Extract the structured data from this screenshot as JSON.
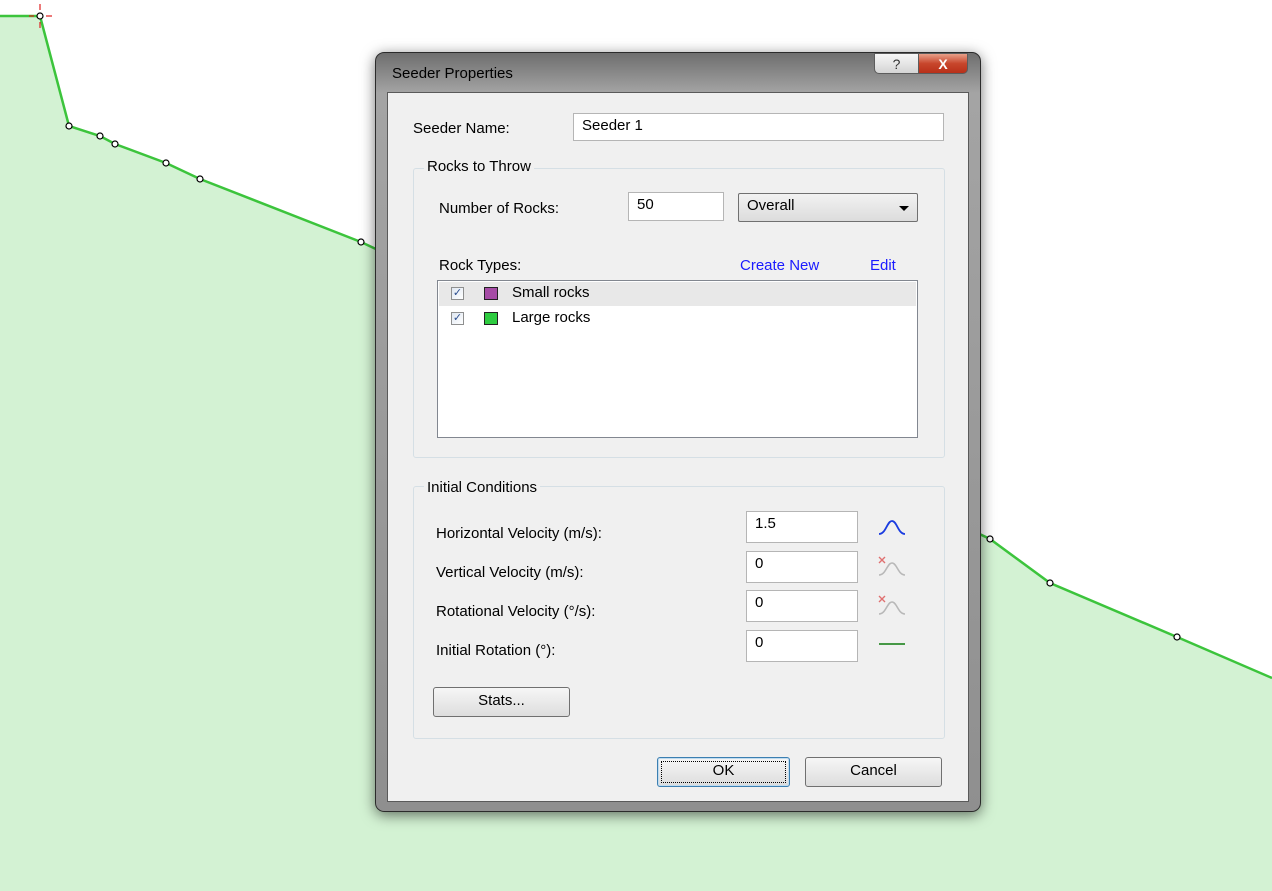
{
  "dialog": {
    "title": "Seeder Properties",
    "help_glyph": "?",
    "close_glyph": "X",
    "seeder_name_label": "Seeder Name:",
    "seeder_name_value": "Seeder 1",
    "rocks_group": {
      "title": "Rocks to Throw",
      "number_label": "Number of Rocks:",
      "number_value": "50",
      "mode_selected": "Overall",
      "rock_types_label": "Rock Types:",
      "create_new_link": "Create New",
      "edit_link": "Edit",
      "items": [
        {
          "label": "Small rocks",
          "checked": true,
          "color": "#a64ca6"
        },
        {
          "label": "Large rocks",
          "checked": true,
          "color": "#2ecc40"
        }
      ]
    },
    "initial_group": {
      "title": "Initial Conditions",
      "rows": [
        {
          "label": "Horizontal Velocity (m/s):",
          "value": "1.5",
          "icon": "normal-distribution-icon"
        },
        {
          "label": "Vertical Velocity (m/s):",
          "value": "0",
          "icon": "distribution-disabled-icon"
        },
        {
          "label": "Rotational Velocity (°/s):",
          "value": "0",
          "icon": "distribution-disabled-icon"
        },
        {
          "label": "Initial Rotation (°):",
          "value": "0",
          "icon": "constant-line-icon"
        }
      ],
      "stats_button": "Stats..."
    },
    "ok_button": "OK",
    "cancel_button": "Cancel"
  },
  "colors": {
    "slope_fill": "#d3f2d3",
    "slope_line": "#3cc43c",
    "accent_link": "#1a1aff"
  }
}
